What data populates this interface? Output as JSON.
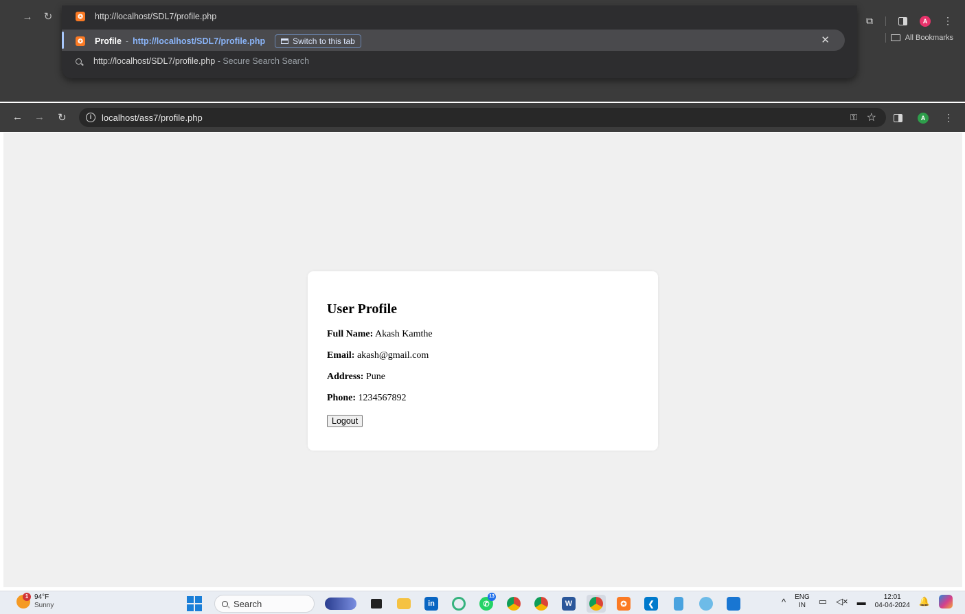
{
  "omnibox_dropdown": {
    "input_url": "http://localhost/SDL7/profile.php",
    "selected_suggestion": {
      "title": "Profile",
      "separator": "-",
      "url": "http://localhost/SDL7/profile.php",
      "switch_label": "Switch to this tab"
    },
    "search_suggestion": {
      "text": "http://localhost/SDL7/profile.php",
      "suffix": "- Secure Search Search"
    },
    "close_glyph": "✕"
  },
  "top_toolbar": {
    "avatar_letter": "A",
    "avatar_color": "#e8336b",
    "bookmarks_label": "All Bookmarks"
  },
  "browser_toolbar": {
    "url": "localhost/ass7/profile.php",
    "avatar_letter": "A",
    "avatar_color": "#2e9e4b"
  },
  "profile": {
    "heading": "User Profile",
    "full_name_label": "Full Name:",
    "full_name_value": "Akash Kamthe",
    "email_label": "Email:",
    "email_value": "akash@gmail.com",
    "address_label": "Address:",
    "address_value": "Pune",
    "phone_label": "Phone:",
    "phone_value": "1234567892",
    "logout_label": "Logout"
  },
  "taskbar": {
    "weather_temp": "94°F",
    "weather_desc": "Sunny",
    "weather_badge": "1",
    "search_label": "Search",
    "whatsapp_badge": "13",
    "language_top": "ENG",
    "language_bottom": "IN",
    "time": "12:01",
    "date": "04-04-2024"
  }
}
